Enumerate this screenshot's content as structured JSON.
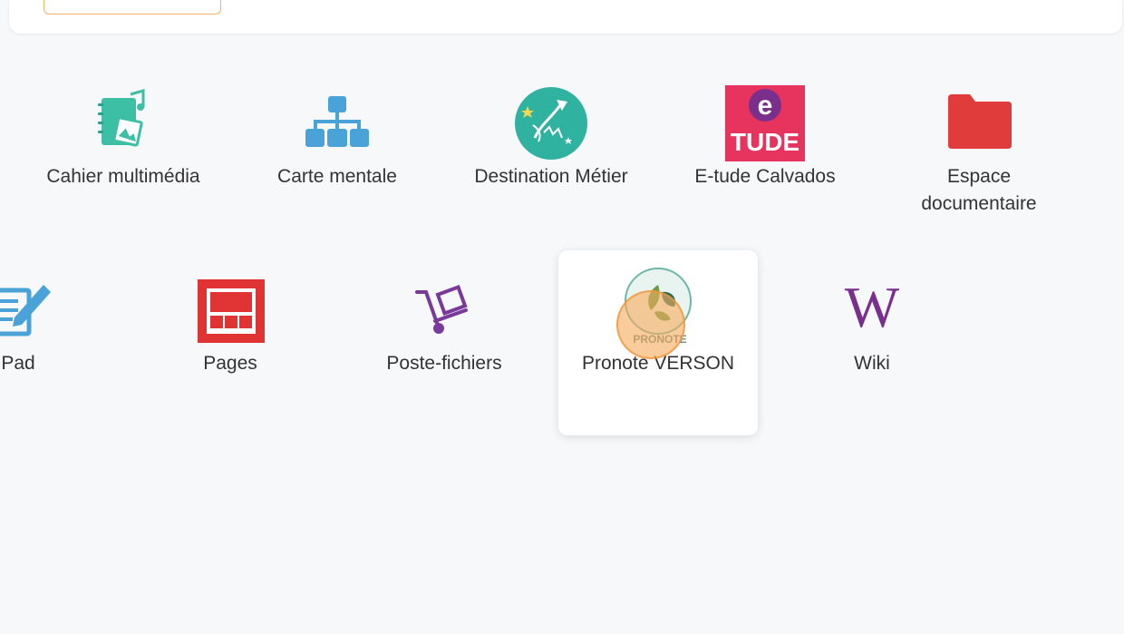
{
  "apps_row1": [
    {
      "name": "cahier-multimedia",
      "label": "Cahier multimédia"
    },
    {
      "name": "carte-mentale",
      "label": "Carte mentale"
    },
    {
      "name": "destination-metier",
      "label": "Destination Métier"
    },
    {
      "name": "etude-calvados",
      "label": "E-tude Calvados",
      "logo_top": "e",
      "logo_bottom": "TUDE"
    },
    {
      "name": "espace-documentaire",
      "label": "Espace documentaire"
    }
  ],
  "apps_row2": [
    {
      "name": "pad",
      "label": "Pad"
    },
    {
      "name": "pages",
      "label": "Pages"
    },
    {
      "name": "poste-fichiers",
      "label": "Poste-fichiers"
    },
    {
      "name": "pronote-verson",
      "label": "Pronote VERSON",
      "logo_text": "PRONOTE"
    },
    {
      "name": "wiki",
      "label": "Wiki",
      "logo_text": "W"
    }
  ],
  "colors": {
    "teal": "#3cbfa4",
    "blue": "#4aa3d8",
    "etude_pink": "#e6345f",
    "etude_purple": "#7a2f8c",
    "folder_red": "#e03c3c",
    "pages_red": "#e03434",
    "purple": "#7a3a9a"
  }
}
